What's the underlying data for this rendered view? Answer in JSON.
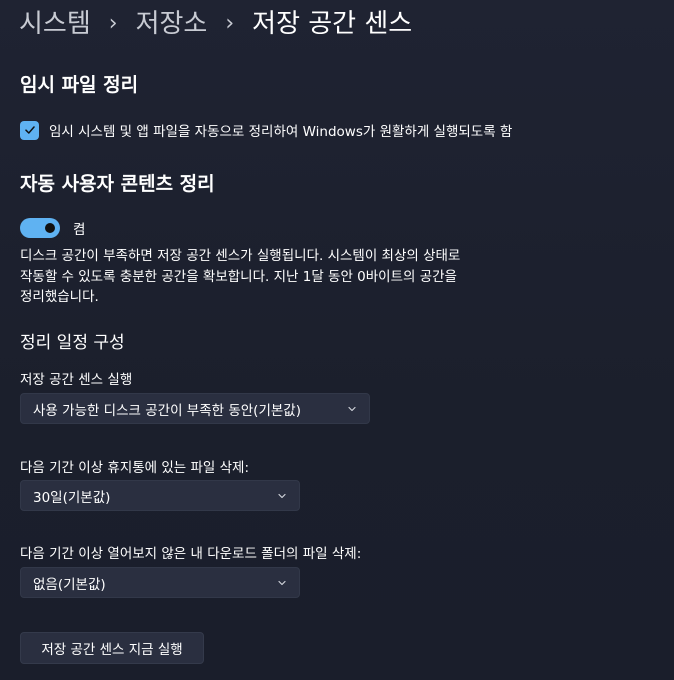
{
  "breadcrumb": {
    "items": [
      "시스템",
      "저장소"
    ],
    "separator": "›",
    "current": "저장 공간 센스"
  },
  "temp_cleanup": {
    "title": "임시 파일 정리",
    "checkbox_label": "임시 시스템 및 앱 파일을 자동으로 정리하여 Windows가 원활하게 실행되도록 함",
    "checkbox_checked": true
  },
  "auto_cleanup": {
    "title": "자동 사용자 콘텐츠 정리",
    "toggle_label": "켬",
    "toggle_on": true,
    "description": "디스크 공간이 부족하면 저장 공간 센스가 실행됩니다. 시스템이 최상의 상태로 작동할 수 있도록 충분한 공간을 확보합니다. 지난 1달 동안 0바이트의 공간을 정리했습니다."
  },
  "schedule": {
    "title": "정리 일정 구성",
    "run_label": "저장 공간 센스 실행",
    "run_value": "사용 가능한 디스크 공간이 부족한 동안(기본값)",
    "recycle_label": "다음 기간 이상 휴지통에 있는 파일 삭제:",
    "recycle_value": "30일(기본값)",
    "downloads_label": "다음 기간 이상 열어보지 않은 내 다운로드 폴더의 파일 삭제:",
    "downloads_value": "없음(기본값)"
  },
  "run_now_button": "저장 공간 센스 지금 실행",
  "colors": {
    "accent": "#5fb2f2",
    "background": "#1c2030",
    "control": "#2a2f40"
  },
  "icons": {
    "check": "check-icon",
    "chevron": "chevron-down-icon"
  }
}
